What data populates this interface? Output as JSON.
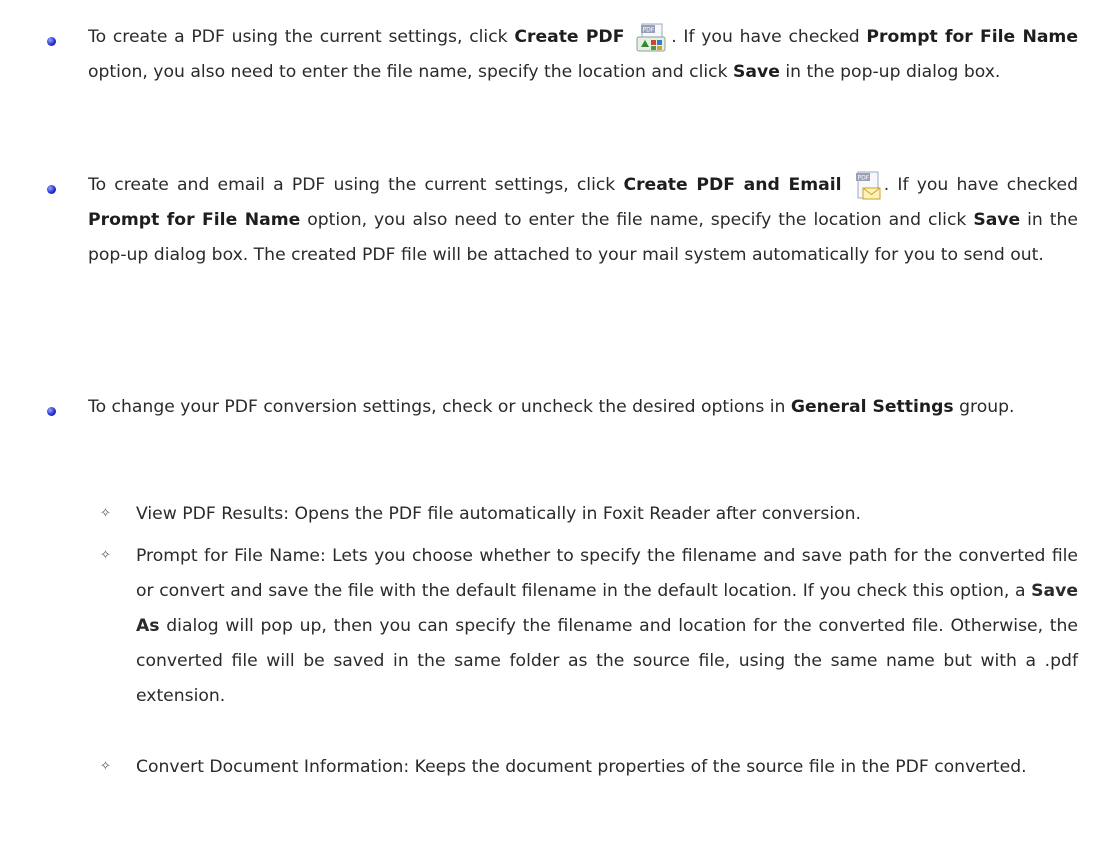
{
  "bullets": [
    {
      "parts": {
        "a": "To create a PDF using the current settings, click ",
        "b1": "Create PDF",
        "c": ". If you have checked ",
        "b2": "Prompt for File Name",
        "d": " option, you also need to enter the file name, specify the location and click ",
        "b3": "Save",
        "e": " in the pop-up dialog box."
      },
      "icon": "create-pdf-icon"
    },
    {
      "parts": {
        "a": "To create and email a PDF using the current settings, click ",
        "b1": "Create PDF and Email",
        "c": ". If you have checked ",
        "b2": "Prompt for File Name",
        "d": " option, you also need to enter the file name, specify the location and click ",
        "b3": "Save",
        "e": " in the pop-up dialog box. The created PDF file will be attached to your mail system automatically for you to send out."
      },
      "icon": "create-pdf-email-icon"
    },
    {
      "parts": {
        "a": "To change your PDF conversion settings, check or uncheck the desired options in ",
        "b1": "General Settings",
        "c": " group."
      }
    }
  ],
  "sub_items": [
    {
      "text": "View PDF Results: Opens the PDF file automatically in Foxit Reader after conversion."
    },
    {
      "a": "Prompt for File Name: Lets you choose whether to specify the filename and save path for the converted file or convert and save the file with the default filename in the default location. If you check this option, a ",
      "b": "Save As",
      "c": " dialog will pop up, then you can specify the filename and location for the converted file. Otherwise, the converted file will be saved in the same folder as the source file, using the same name but with a .pdf extension."
    },
    {
      "text": "Convert Document Information: Keeps the document properties of the source file in the PDF converted."
    }
  ],
  "marker_symbol": "✧",
  "colors": {
    "bullet": "#2b2fd1",
    "text": "#2a2a2a"
  }
}
